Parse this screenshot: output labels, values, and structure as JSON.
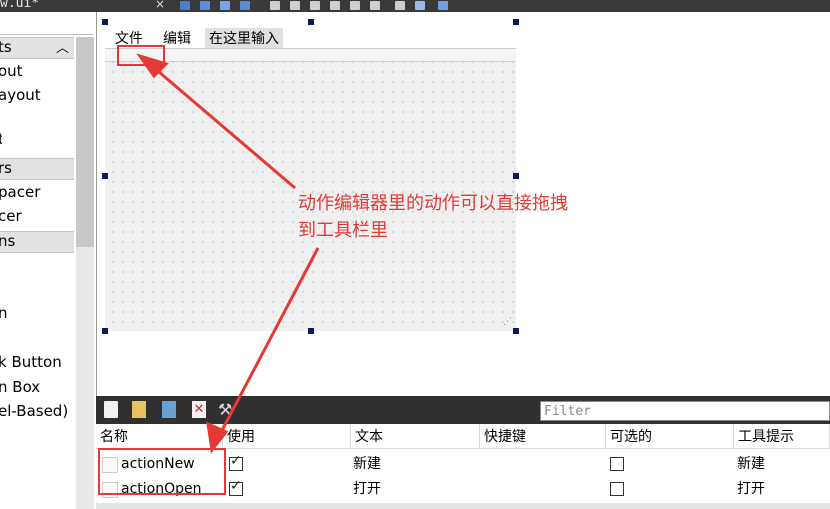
{
  "window": {
    "file_name": "w.ui*",
    "close_glyph": "×"
  },
  "widget_box": {
    "categories": [
      {
        "label": "ts"
      },
      {
        "label": "rs"
      },
      {
        "label": "ns"
      }
    ],
    "layouts": [
      "out",
      "ayout"
    ],
    "spacers": [
      "pacer",
      "cer"
    ],
    "buttons": [
      "n",
      "k Button",
      "n Box",
      "el-Based)"
    ],
    "misc": [
      "t"
    ]
  },
  "form": {
    "menus": [
      "文件",
      "编辑",
      "在这里输入"
    ]
  },
  "annotation": {
    "line1": "动作编辑器里的动作可以直接拖拽",
    "line2": "到工具栏里"
  },
  "action_editor": {
    "filter_placeholder": "Filter",
    "columns": [
      "名称",
      "使用",
      "文本",
      "快捷键",
      "可选的",
      "工具提示"
    ],
    "rows": [
      {
        "name": "actionNew",
        "used": true,
        "text": "新建",
        "shortcut": "",
        "checkable": false,
        "tooltip": "新建"
      },
      {
        "name": "actionOpen",
        "used": true,
        "text": "打开",
        "shortcut": "",
        "checkable": false,
        "tooltip": "打开"
      }
    ]
  },
  "colors": {
    "annotation": "#e53935",
    "handle": "#0a1a5a",
    "toolbar_dark": "#303030"
  }
}
